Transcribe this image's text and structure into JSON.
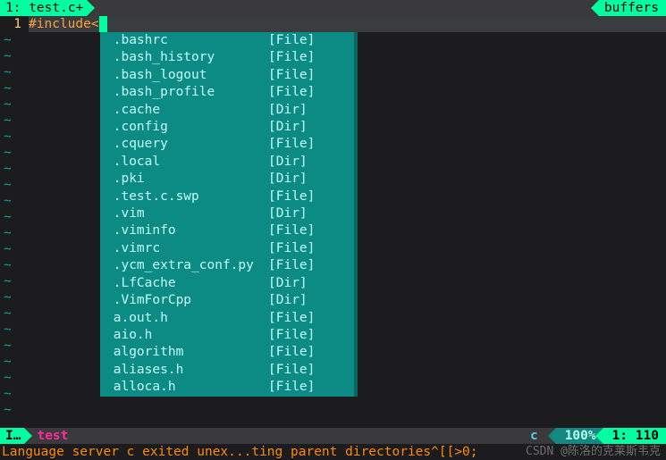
{
  "tabs": {
    "left": "1: test.c+",
    "right": "buffers"
  },
  "code": {
    "line_number": "1",
    "include_text": "#include<",
    "empty_marker": "~"
  },
  "completion": {
    "items": [
      {
        "name": ".bashrc",
        "kind": "[File]"
      },
      {
        "name": ".bash_history",
        "kind": "[File]"
      },
      {
        "name": ".bash_logout",
        "kind": "[File]"
      },
      {
        "name": ".bash_profile",
        "kind": "[File]"
      },
      {
        "name": ".cache",
        "kind": "[Dir]"
      },
      {
        "name": ".config",
        "kind": "[Dir]"
      },
      {
        "name": ".cquery",
        "kind": "[File]"
      },
      {
        "name": ".local",
        "kind": "[Dir]"
      },
      {
        "name": ".pki",
        "kind": "[Dir]"
      },
      {
        "name": ".test.c.swp",
        "kind": "[File]"
      },
      {
        "name": ".vim",
        "kind": "[Dir]"
      },
      {
        "name": ".viminfo",
        "kind": "[File]"
      },
      {
        "name": ".vimrc",
        "kind": "[File]"
      },
      {
        "name": ".ycm_extra_conf.py",
        "kind": "[File]"
      },
      {
        "name": ".LfCache",
        "kind": "[Dir]"
      },
      {
        "name": ".VimForCpp",
        "kind": "[Dir]"
      },
      {
        "name": "a.out.h",
        "kind": "[File]"
      },
      {
        "name": "aio.h",
        "kind": "[File]"
      },
      {
        "name": "algorithm",
        "kind": "[File]"
      },
      {
        "name": "aliases.h",
        "kind": "[File]"
      },
      {
        "name": "alloca.h",
        "kind": "[File]"
      }
    ]
  },
  "status": {
    "mode": "I…",
    "filename": "test",
    "filetype": "c",
    "percent": "100%",
    "position": "1: 110"
  },
  "message": "Language server c exited unex...ting parent directories^[[>0;",
  "watermark": "CSDN @陈洛的克莱斯韦克"
}
